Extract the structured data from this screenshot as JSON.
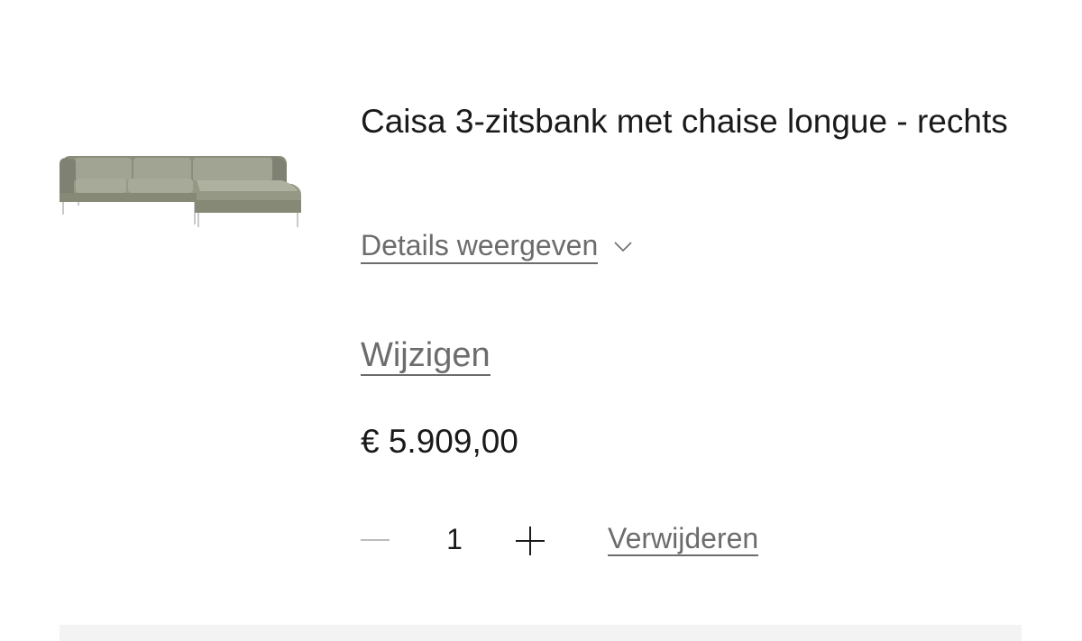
{
  "product": {
    "title": "Caisa 3-zitsbank met chaise longue - rechts",
    "details_link": "Details weergeven",
    "edit_link": "Wijzigen",
    "price": "€ 5.909,00",
    "image_icon": "sofa-image"
  },
  "quantity": {
    "value": "1",
    "decrement_icon": "minus-icon",
    "increment_icon": "plus-icon"
  },
  "actions": {
    "remove_label": "Verwijderen"
  },
  "colors": {
    "text": "#1a1a1a",
    "link": "#6c6c6c",
    "sofa_fabric": "#9a9d8a",
    "panel": "#f3f3f3"
  }
}
